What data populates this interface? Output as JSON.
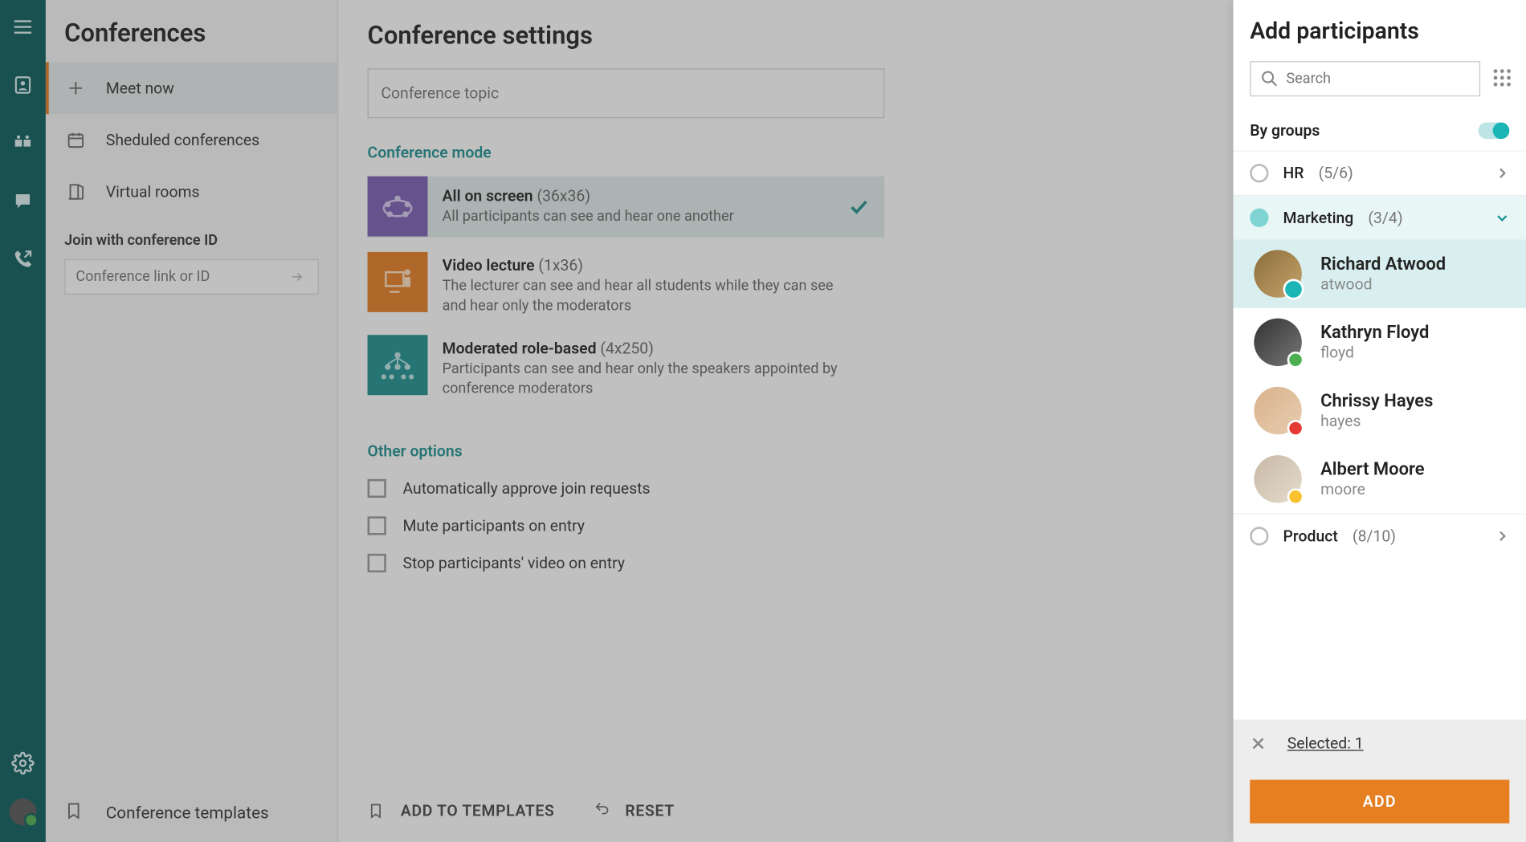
{
  "sidebar": {
    "title": "Conferences",
    "nav": {
      "meet_now": "Meet now",
      "scheduled": "Sheduled conferences",
      "virtual_rooms": "Virtual rooms"
    },
    "join_label": "Join with conference ID",
    "join_placeholder": "Conference link or ID",
    "templates": "Conference templates"
  },
  "main": {
    "title": "Conference settings",
    "topic_placeholder": "Conference topic",
    "mode_label": "Conference mode",
    "modes": [
      {
        "title": "All on screen",
        "dims": "(36x36)",
        "desc": "All participants can see and hear one another",
        "selected": true
      },
      {
        "title": "Video lecture",
        "dims": "(1x36)",
        "desc": "The lecturer can see and hear all students while they can see and hear only the moderators",
        "selected": false
      },
      {
        "title": "Moderated role-based",
        "dims": "(4x250)",
        "desc": "Participants can see and hear only the speakers appointed by conference moderators",
        "selected": false
      }
    ],
    "other_label": "Other options",
    "opts": [
      "Automatically approve join requests",
      "Mute participants on entry",
      "Stop participants' video on entry"
    ],
    "footer": {
      "add_templates": "ADD TO TEMPLATES",
      "reset": "RESET"
    }
  },
  "panel": {
    "title": "Add participants",
    "search_placeholder": "Search",
    "by_groups": "By groups",
    "groups": [
      {
        "name": "HR",
        "count": "(5/6)",
        "expanded": false
      },
      {
        "name": "Marketing",
        "count": "(3/4)",
        "expanded": true
      },
      {
        "name": "Product",
        "count": "(8/10)",
        "expanded": false
      }
    ],
    "marketing_members": [
      {
        "name": "Richard Atwood",
        "handle": "atwood",
        "selected": true,
        "status": "sel"
      },
      {
        "name": "Kathryn Floyd",
        "handle": "floyd",
        "selected": false,
        "status": "green"
      },
      {
        "name": "Chrissy Hayes",
        "handle": "hayes",
        "selected": false,
        "status": "red"
      },
      {
        "name": "Albert Moore",
        "handle": "moore",
        "selected": false,
        "status": "yellow"
      }
    ],
    "selected_label": "Selected: 1",
    "add_button": "ADD"
  }
}
